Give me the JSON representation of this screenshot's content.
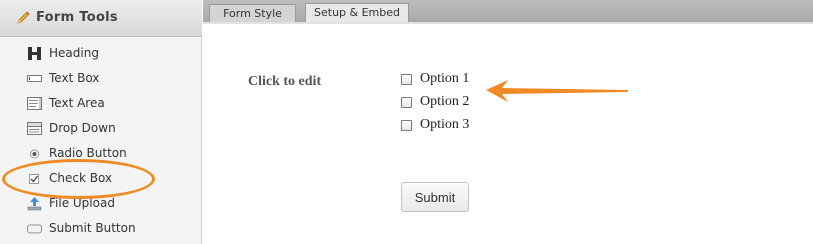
{
  "sidebar": {
    "title": "Form Tools",
    "items": [
      {
        "label": "Heading",
        "icon": "heading-icon"
      },
      {
        "label": "Text Box",
        "icon": "textbox-icon"
      },
      {
        "label": "Text Area",
        "icon": "textarea-icon"
      },
      {
        "label": "Drop Down",
        "icon": "dropdown-icon"
      },
      {
        "label": "Radio Button",
        "icon": "radio-icon"
      },
      {
        "label": "Check Box",
        "icon": "checkbox-icon"
      },
      {
        "label": "File Upload",
        "icon": "upload-icon"
      },
      {
        "label": "Submit Button",
        "icon": "submit-button-icon"
      }
    ]
  },
  "tabs": [
    {
      "label": "Form Style",
      "active": false
    },
    {
      "label": "Setup & Embed",
      "active": true
    }
  ],
  "form": {
    "label": "Click to edit",
    "options": [
      "Option 1",
      "Option 2",
      "Option 3"
    ],
    "submit_label": "Submit"
  },
  "colors": {
    "annotation": "#f08a24"
  }
}
